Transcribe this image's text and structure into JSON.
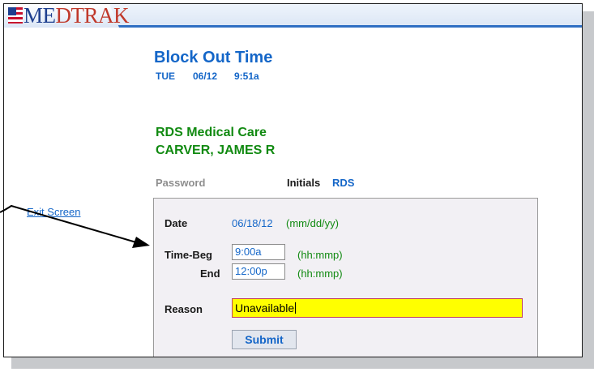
{
  "app": {
    "logo_prefix": "ME",
    "logo_suffix": "DTRAK"
  },
  "header": {
    "title": "Block Out Time",
    "day": "TUE",
    "date": "06/12",
    "time": "9:51a"
  },
  "context": {
    "practice": "RDS Medical Care",
    "patient": "CARVER, JAMES R",
    "password_label": "Password",
    "initials_label": "Initials",
    "initials_value": "RDS"
  },
  "nav": {
    "exit_label": "Exit Screen"
  },
  "form": {
    "date_label": "Date",
    "date_value": "06/18/12",
    "date_hint": "(mm/dd/yy)",
    "time_beg_label": "Time-Beg",
    "time_beg_value": "9:00a",
    "time_beg_hint": "(hh:mmp)",
    "time_end_label": "End",
    "time_end_value": "12:00p",
    "time_end_hint": "(hh:mmp)",
    "reason_label": "Reason",
    "reason_value": "Unavailable",
    "submit_label": "Submit"
  },
  "colors": {
    "accent_blue": "#1466c8",
    "accent_green": "#118a11",
    "focus_field": "#ffff00"
  }
}
